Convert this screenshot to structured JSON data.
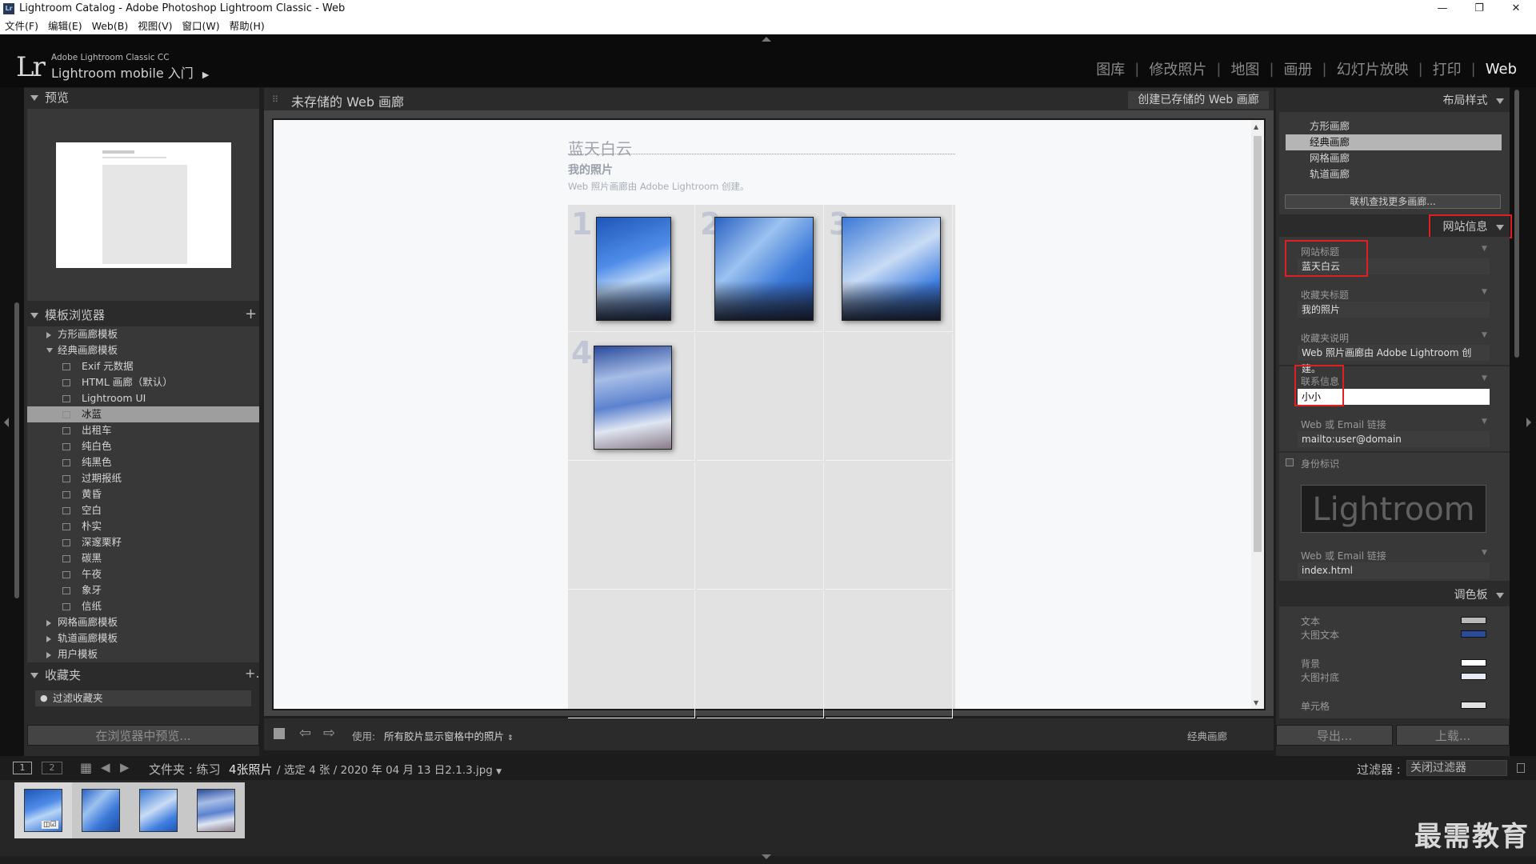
{
  "window": {
    "title": "Lightroom Catalog - Adobe Photoshop Lightroom Classic - Web",
    "app_icon": "Lr",
    "minimize": "—",
    "restore": "❐",
    "close": "✕"
  },
  "menu": [
    "文件(F)",
    "编辑(E)",
    "Web(B)",
    "视图(V)",
    "窗口(W)",
    "帮助(H)"
  ],
  "identity": {
    "logo": "Lr",
    "small": "Adobe Lightroom Classic CC",
    "big": "Lightroom mobile 入门",
    "arrow": "▶"
  },
  "modules": [
    "图库",
    "修改照片",
    "地图",
    "画册",
    "幻灯片放映",
    "打印",
    "Web"
  ],
  "left": {
    "preview_header": "预览",
    "template_header": "模板浏览器",
    "template_add": "+",
    "templates": [
      {
        "label": "方形画廊模板",
        "type": "folder",
        "open": false
      },
      {
        "label": "经典画廊模板",
        "type": "folder",
        "open": true
      },
      {
        "label": "Exif 元数据",
        "type": "item"
      },
      {
        "label": "HTML 画廊（默认）",
        "type": "item"
      },
      {
        "label": "Lightroom UI",
        "type": "item"
      },
      {
        "label": "冰蓝",
        "type": "item",
        "selected": true
      },
      {
        "label": "出租车",
        "type": "item"
      },
      {
        "label": "纯白色",
        "type": "item"
      },
      {
        "label": "纯黑色",
        "type": "item"
      },
      {
        "label": "过期报纸",
        "type": "item"
      },
      {
        "label": "黄昏",
        "type": "item"
      },
      {
        "label": "空白",
        "type": "item"
      },
      {
        "label": "朴实",
        "type": "item"
      },
      {
        "label": "深邃栗籽",
        "type": "item"
      },
      {
        "label": "碳黑",
        "type": "item"
      },
      {
        "label": "午夜",
        "type": "item"
      },
      {
        "label": "象牙",
        "type": "item"
      },
      {
        "label": "信纸",
        "type": "item"
      },
      {
        "label": "网格画廊模板",
        "type": "folder",
        "open": false
      },
      {
        "label": "轨道画廊模板",
        "type": "folder",
        "open": false
      },
      {
        "label": "用户模板",
        "type": "folder",
        "open": false
      }
    ],
    "collections_header": "收藏夹",
    "collections_add": "+.",
    "filter_placeholder": "过滤收藏夹",
    "preview_button": "在浏览器中预览..."
  },
  "center": {
    "gallery_title": "未存储的 Web 画廊",
    "create_button": "创建已存储的 Web 画廊",
    "site_title": "蓝天白云",
    "collection_title": "我的照片",
    "collection_desc": "Web 照片画廊由 Adobe Lightroom 创建。",
    "cells": [
      "1",
      "2",
      "3",
      "4"
    ],
    "toolbar": {
      "use_label": "使用:",
      "use_value": "所有胶片显示窗格中的照片",
      "layout_name": "经典画廊"
    }
  },
  "right": {
    "layout_header": "布局样式",
    "layouts": [
      "方形画廊",
      "经典画廊",
      "网格画廊",
      "轨道画廊"
    ],
    "selected_layout": 1,
    "find_more": "联机查找更多画廊...",
    "siteinfo_header": "网站信息",
    "fields": [
      {
        "label": "网站标题",
        "value": "蓝天白云"
      },
      {
        "label": "收藏夹标题",
        "value": "我的照片"
      },
      {
        "label": "收藏夹说明",
        "value": "Web 照片画廊由 Adobe Lightroom 创建。"
      },
      {
        "label": "联系信息",
        "value": "小小"
      },
      {
        "label": "Web 或 Email 链接",
        "value": "mailto:user@domain"
      }
    ],
    "identity_plate_label": "身份标识",
    "identity_plate_text": "Lightroom",
    "link2": {
      "label": "Web 或 Email 链接",
      "value": "index.html"
    },
    "color_header": "调色板",
    "colors": [
      {
        "label": "文本",
        "color": "#b9b9b9"
      },
      {
        "label": "大图文本",
        "color": "#2a4a9a"
      },
      {
        "label": "背景",
        "color": "#ffffff"
      },
      {
        "label": "大图衬底",
        "color": "#e6eaf5"
      },
      {
        "label": "单元格",
        "color": "#e2e2e2"
      }
    ],
    "export_button": "导出...",
    "upload_button": "上载..."
  },
  "filmstrip": {
    "page1": "1",
    "page2": "2",
    "folder": "文件夹 : 练习",
    "count": "4张照片",
    "selection": "/ 选定 4 张 / 2020 年 04 月 13 日2.1.3.jpg",
    "filter_label": "过滤器 :",
    "filter_value": "关闭过滤器"
  },
  "watermark": "最需教育"
}
